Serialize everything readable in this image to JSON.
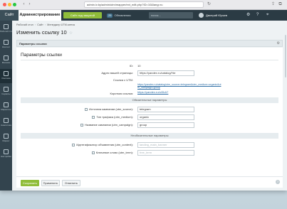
{
  "browser": {
    "url": "admin.iv.by/admin/utm/mapper/ext_edit.php?ID=10&lang=ru",
    "dot_colors": [
      "#fd5f57",
      "#febc2e",
      "#28c840"
    ]
  },
  "topbar": {
    "site_tab": "Сайт",
    "admin_tab": "Администрирование",
    "quick_button": "Сайт под защитой",
    "updates_count": "25",
    "updates_label": "Обновления",
    "search_placeholder": "поиск...",
    "user_name": "Дмитрий Юрьев",
    "accent_color": "#8fbd3a"
  },
  "sidebar": {
    "items": [
      {
        "label": "Рабочий стол",
        "icon": "desktop-icon"
      },
      {
        "label": "Контент",
        "icon": "content-icon"
      },
      {
        "label": "Магазин",
        "icon": "cart-icon"
      },
      {
        "label": "Рекламa",
        "icon": "target-icon"
      },
      {
        "label": "Сервисы",
        "icon": "services-icon"
      },
      {
        "label": "Маркетинг",
        "icon": "marketing-icon"
      },
      {
        "label": "Аналитика",
        "icon": "chart-icon"
      },
      {
        "label": "Маркет",
        "icon": "market-icon"
      },
      {
        "label": "Настройки",
        "icon": "settings-icon"
      }
    ]
  },
  "page": {
    "breadcrumbs": [
      "Рабочий стол",
      "Сайт",
      "Менеджер UTM-меток"
    ],
    "title": "Изменить ссылку 10",
    "tab_label": "Параметры ссылки",
    "section_title": "Параметры ссылки",
    "id_label": "ID:",
    "id_value": "10",
    "url_label": "Адрес вашей страницы:",
    "url_value": "https://yandex.ru/catalog/%e",
    "full_link_label": "Ссылка с UTM:",
    "full_link_value": "https://yandex.ru/catalog/utm_source=telegram&utm_medium=organic&utm_campaign=group",
    "short_link_label": "Короткая ссылка:",
    "short_link_value": "https://yandex.ru/u/0bA7",
    "group_required": "Обязательные параметры",
    "source_label": "Источник кампании (utm_source):",
    "source_value": "telegram",
    "medium_label": "Тип трафика (utm_medium):",
    "medium_value": "organic",
    "campaign_label": "Название кампании (utm_campaign):",
    "campaign_value": "group",
    "group_optional": "Необязательные параметры",
    "content_label": "Идентификатор объявления (utm_content):",
    "content_placeholder": "landing_main_banner",
    "term_label": "Ключевое слово (utm_term):",
    "term_placeholder": "free_term"
  },
  "footer": {
    "save": "Сохранить",
    "apply": "Применить",
    "cancel": "Отменить"
  }
}
